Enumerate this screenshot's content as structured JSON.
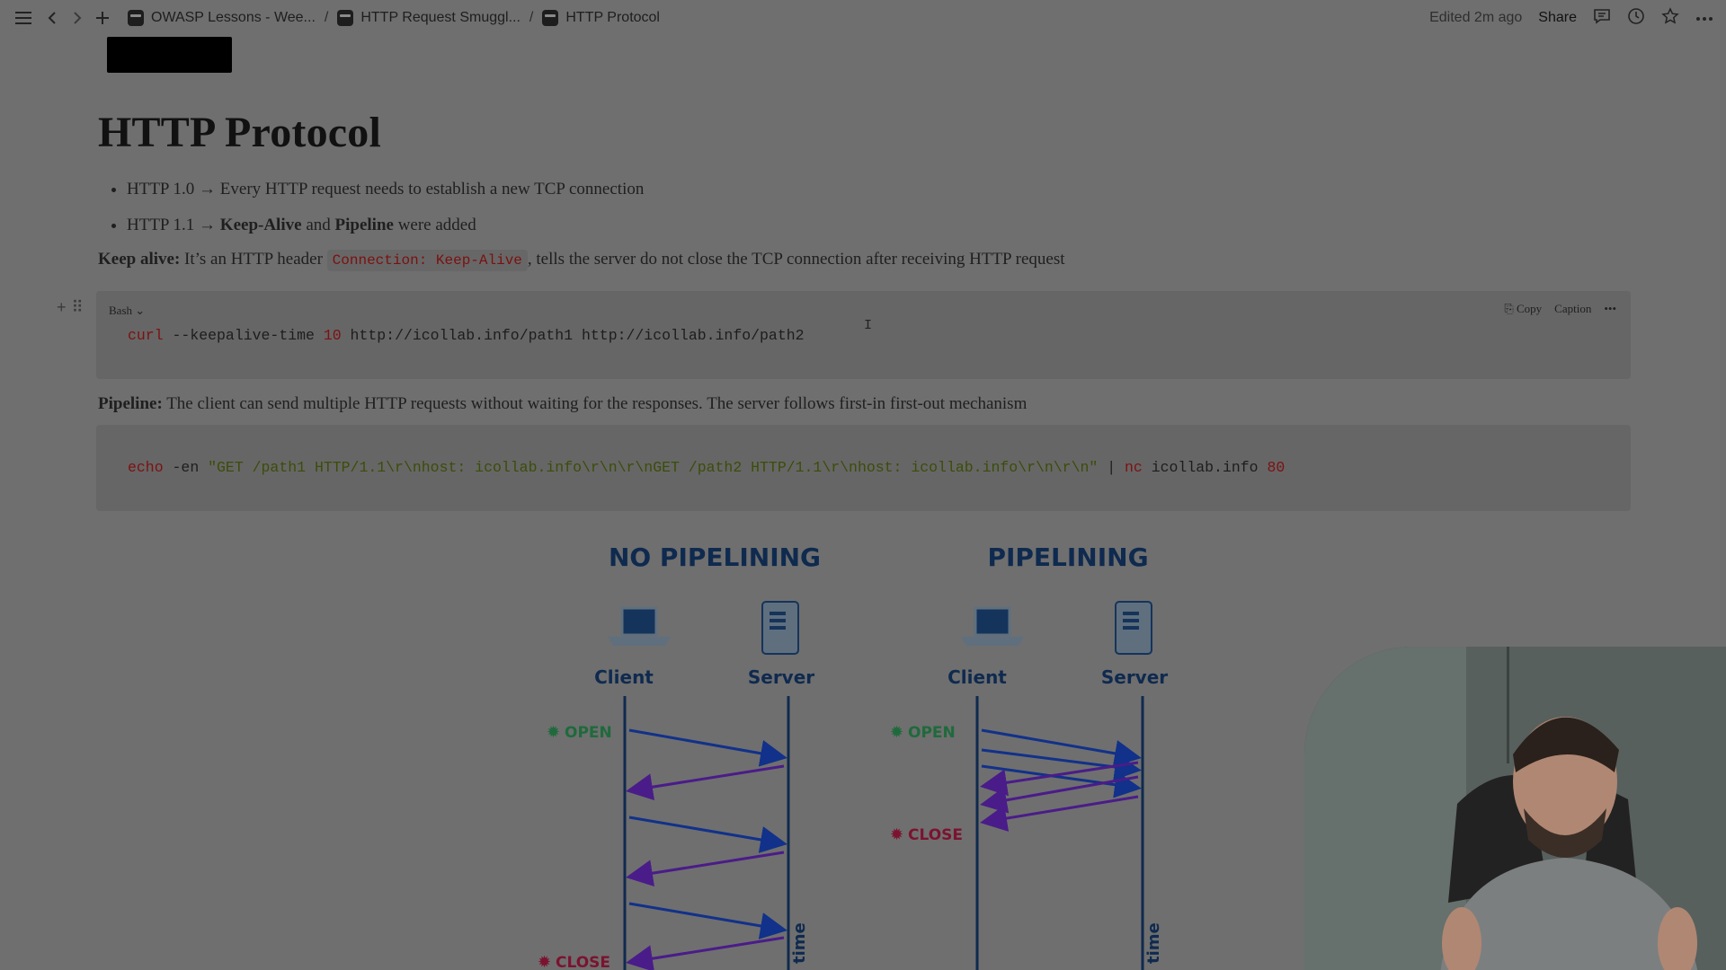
{
  "topbar": {
    "breadcrumbs": [
      {
        "label": "OWASP Lessons - Wee..."
      },
      {
        "label": "HTTP Request Smuggl..."
      },
      {
        "label": "HTTP Protocol"
      }
    ],
    "edited": "Edited 2m ago",
    "share": "Share"
  },
  "page": {
    "title": "HTTP Protocol",
    "bullets": [
      {
        "pre": "HTTP 1.0 → Every HTTP request needs to establish a new TCP connection"
      },
      {
        "pre": "HTTP 1.1 → ",
        "b1": "Keep-Alive",
        "mid": " and ",
        "b2": "Pipeline",
        "post": " were added"
      }
    ],
    "keepalive": {
      "label": "Keep alive:",
      "pre": " It’s an HTTP header ",
      "code": "Connection: Keep-Alive",
      "post": ", tells the server do not close the TCP connection after receiving HTTP request"
    },
    "pipeline": {
      "label": "Pipeline:",
      "text": " The client can send multiple HTTP requests without waiting for the responses. The server follows first-in first-out mechanism"
    }
  },
  "codeblock1": {
    "language": "Bash",
    "copy": "Copy",
    "caption": "Caption",
    "cmd": "curl",
    "arg1": " --keepalive-time ",
    "num": "10",
    "arg2": " http://icollab.info/path1 http://icollab.info/path2"
  },
  "codeblock2": {
    "cmd": "echo",
    "arg1": " -en ",
    "str": "\"GET /path1 HTTP/1.1\\r\\nhost: icollab.info\\r\\n\\r\\nGET /path2 HTTP/1.1\\r\\nhost: icollab.info\\r\\n\\r\\n\"",
    "pipe": " | ",
    "cmd2": "nc",
    "arg2": " icollab.info ",
    "num": "80"
  },
  "diagram": {
    "left_title": "NO PIPELINING",
    "right_title": "PIPELINING",
    "client": "Client",
    "server": "Server",
    "open": "OPEN",
    "close": "CLOSE",
    "time": "time",
    "colors": {
      "title": "#0f2a4f",
      "open": "#1f6a3c",
      "close": "#7b1330",
      "line": "#0f2a4f",
      "request": "#11318a",
      "response": "#4a1c89"
    }
  }
}
